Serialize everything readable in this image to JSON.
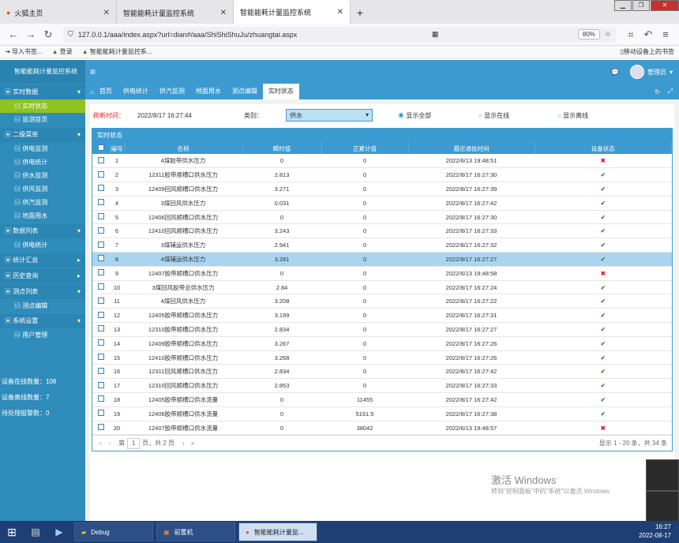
{
  "browser": {
    "tabs": [
      {
        "title": "火狐主页"
      },
      {
        "title": "智能能耗计量监控系统"
      },
      {
        "title": "智能能耗计量监控系统"
      }
    ],
    "url": "127.0.0.1/aaa/index.aspx?url=dian#/aaa/ShiShiShuJu/zhuangtai.aspx",
    "zoom": "80%",
    "bookmarks": [
      "导入书签...",
      "登录",
      "智能能耗计量监控系..."
    ],
    "mobile_bookmarks": "移动设备上的书签"
  },
  "sidebar": {
    "title": "智能能耗计量监控系统",
    "sections": [
      {
        "label": "实时数据",
        "items": [
          "实时状态",
          "监测首页"
        ]
      },
      {
        "label": "二级菜单",
        "items": [
          "供电监测",
          "供电统计",
          "供水监测",
          "供风监测",
          "供汽监测",
          "地面用水"
        ]
      },
      {
        "label": "数据列表",
        "items": [
          "供电统计"
        ]
      },
      {
        "label": "统计汇总",
        "items": []
      },
      {
        "label": "历史查询",
        "items": []
      },
      {
        "label": "测点列表",
        "items": [
          "测点编辑"
        ]
      },
      {
        "label": "系统设置",
        "items": [
          "用户管理"
        ]
      }
    ],
    "stats": [
      "设备在线数量：108",
      "设备离线数量：7",
      "待处理报警数：0"
    ]
  },
  "header": {
    "admin": "管理员"
  },
  "page_tabs": [
    "首页",
    "供电统计",
    "供汽监测",
    "地面用水",
    "测点编辑",
    "实时状态"
  ],
  "filter": {
    "time_label": "刷新时间：",
    "time_value": "2022/8/17 16:27:44",
    "category_label": "类别：",
    "category_value": "供水",
    "radio": [
      "显示全部",
      "显示在线",
      "显示离线"
    ]
  },
  "panel_title": "实时状态",
  "table": {
    "headers": [
      "编号",
      "名称",
      "瞬时值",
      "正累计值",
      "最近通信时间",
      "设备状态"
    ],
    "rows": [
      [
        "1",
        "4煤胶带供水压力",
        "0",
        "0",
        "2022/6/13 19:48:51",
        "bad"
      ],
      [
        "2",
        "12311胶带顺槽口供水压力",
        "2.813",
        "0",
        "2022/8/17 16:27:30",
        "ok"
      ],
      [
        "3",
        "12409回风顺槽口供水压力",
        "3.271",
        "0",
        "2022/8/17 16:27:39",
        "ok"
      ],
      [
        "4",
        "3煤回风供水压力",
        "0.031",
        "0",
        "2022/8/17 16:27:42",
        "ok"
      ],
      [
        "5",
        "12406回风顺槽口供水压力",
        "0",
        "0",
        "2022/8/17 16:27:30",
        "ok"
      ],
      [
        "6",
        "12410回风顺槽口供水压力",
        "3.243",
        "0",
        "2022/8/17 16:27:33",
        "ok"
      ],
      [
        "7",
        "3煤辅运供水压力",
        "2.941",
        "0",
        "2022/8/17 16:27:32",
        "ok"
      ],
      [
        "8",
        "4煤辅运供水压力",
        "3.281",
        "0",
        "2022/8/17 16:27:27",
        "ok"
      ],
      [
        "9",
        "12407胶带顺槽口供水压力",
        "0",
        "0",
        "2022/6/13 19:48:58",
        "bad"
      ],
      [
        "10",
        "3煤回风胶带总供水压力",
        "2.84",
        "0",
        "2022/8/17 16:27:24",
        "ok"
      ],
      [
        "11",
        "4煤回风供水压力",
        "3.208",
        "0",
        "2022/8/17 16:27:22",
        "ok"
      ],
      [
        "12",
        "12405胶带顺槽口供水压力",
        "3.199",
        "0",
        "2022/8/17 16:27:31",
        "ok"
      ],
      [
        "13",
        "12310胶带顺槽口供水压力",
        "2.834",
        "0",
        "2022/8/17 16:27:27",
        "ok"
      ],
      [
        "14",
        "12409胶带顺槽口供水压力",
        "3.267",
        "0",
        "2022/8/17 16:27:26",
        "ok"
      ],
      [
        "15",
        "12410胶带顺槽口供水压力",
        "3.268",
        "0",
        "2022/8/17 16:27:26",
        "ok"
      ],
      [
        "16",
        "12311回风顺槽口供水压力",
        "2.834",
        "0",
        "2022/8/17 16:27:42",
        "ok"
      ],
      [
        "17",
        "12310回风顺槽口供水压力",
        "2.853",
        "0",
        "2022/8/17 16:27:33",
        "ok"
      ],
      [
        "18",
        "12405胶带顺槽口供水流量",
        "0",
        "11455",
        "2022/8/17 16:27:42",
        "ok"
      ],
      [
        "19",
        "12406胶带顺槽口供水流量",
        "0",
        "5161.5",
        "2022/8/17 16:27:38",
        "ok"
      ],
      [
        "20",
        "12407胶带顺槽口供水流量",
        "0",
        "38042",
        "2022/6/13 19:48:57",
        "bad"
      ]
    ]
  },
  "pager": {
    "page_label": "第",
    "page_value": "1",
    "total": "页，共 2 页",
    "summary": "显示 1 - 20 条，共 34 条"
  },
  "watermark": {
    "line1": "激活 Windows",
    "line2": "转到\"控制面板\"中的\"系统\"以激活 Windows"
  },
  "taskbar": {
    "items": [
      "Debug",
      "前置机",
      "智能能耗计量监..."
    ],
    "time": "16:27",
    "date": "2022-08-17"
  }
}
